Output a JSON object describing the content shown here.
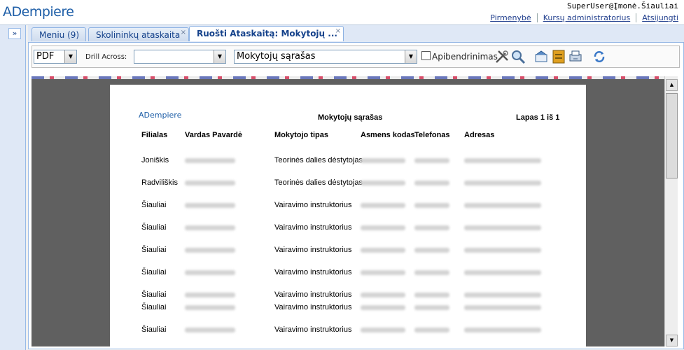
{
  "header": {
    "logo_text": "ADempiere",
    "user": "SuperUser@Įmonė.Šiauliai",
    "links": [
      "Pirmenybė",
      "Kursų administratorius",
      "Atsijungti"
    ]
  },
  "tabs": [
    {
      "label": "Meniu (9)"
    },
    {
      "label": "Skolininkų ataskaita"
    },
    {
      "label": "Ruošti Ataskaitą: Mokytojų ..."
    }
  ],
  "toolbar": {
    "format": "PDF",
    "drill_label": "Drill Across:",
    "drill_value": "",
    "report": "Mokytojų sąrašas",
    "summary_label": "Apibendrinimas",
    "icons": [
      "customize-icon",
      "find-icon",
      "export-icon",
      "archive-icon",
      "print-icon",
      "refresh-icon"
    ]
  },
  "report": {
    "logo_text": "ADempiere",
    "title": "Mokytojų sąrašas",
    "page": "Lapas 1 iš 1",
    "columns": [
      "Filialas",
      "Vardas Pavardė",
      "Mokytojo tipas",
      "Asmens kodas",
      "Telefonas",
      "Adresas"
    ],
    "rows": [
      {
        "branch": "Joniškis",
        "type": "Teorinės dalies dėstytojas"
      },
      {
        "branch": "Radviliškis",
        "type": "Teorinės dalies dėstytojas"
      },
      {
        "branch": "Šiauliai",
        "type": "Vairavimo instruktorius"
      },
      {
        "branch": "Šiauliai",
        "type": "Vairavimo instruktorius"
      },
      {
        "branch": "Šiauliai",
        "type": "Vairavimo instruktorius"
      },
      {
        "branch": "Šiauliai",
        "type": "Vairavimo instruktorius"
      },
      {
        "branch": "Šiauliai",
        "type": "Vairavimo instruktorius"
      },
      {
        "branch": "Šiauliai",
        "type": "Vairavimo instruktorius"
      },
      {
        "branch": "Šiauliai",
        "type": "Vairavimo instruktorius"
      }
    ]
  }
}
